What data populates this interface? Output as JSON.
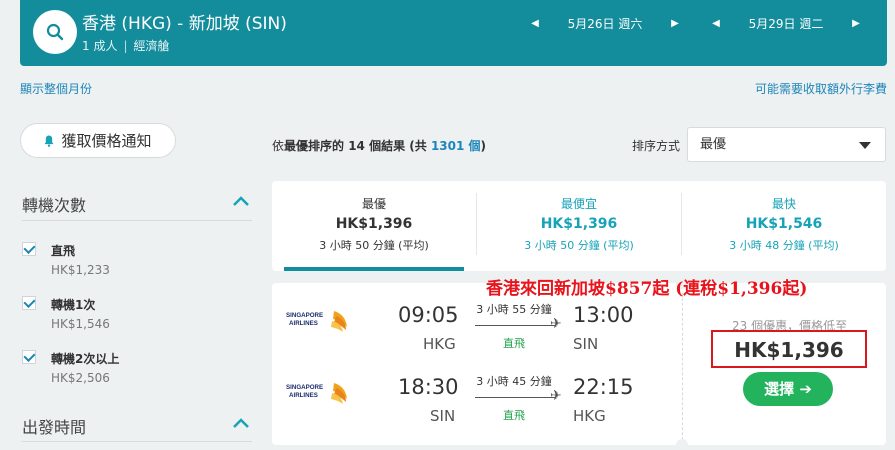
{
  "header": {
    "route": "香港 (HKG) - 新加坡 (SIN)",
    "passengers": "1 成人",
    "cabin": "經濟艙",
    "depart_date": "5月26日 週六",
    "return_date": "5月29日 週二"
  },
  "links": {
    "show_month": "顯示整個月份",
    "extra_fees": "可能需要收取額外行李費"
  },
  "alert_button": "獲取價格通知",
  "filters": {
    "stops": {
      "title": "轉機次數",
      "options": [
        {
          "label": "直飛",
          "price": "HK$1,233"
        },
        {
          "label": "轉機1次",
          "price": "HK$1,546"
        },
        {
          "label": "轉機2次以上",
          "price": "HK$2,506"
        }
      ]
    },
    "departure": {
      "title": "出發時間"
    }
  },
  "results": {
    "prefix": "依",
    "sort_name": "最優",
    "mid": "排序的 14 個結果 (共 ",
    "total": "1301 個",
    "suffix": ")"
  },
  "sort": {
    "label": "排序方式",
    "value": "最優"
  },
  "tabs": [
    {
      "title": "最優",
      "price": "HK$1,396",
      "duration": "3 小時 50 分鐘 (平均)"
    },
    {
      "title": "最便宜",
      "price": "HK$1,396",
      "duration": "3 小時 50 分鐘 (平均)"
    },
    {
      "title": "最快",
      "price": "HK$1,546",
      "duration": "3 小時 48 分鐘 (平均)"
    }
  ],
  "promo": "香港來回新加坡$857起 (連稅$1,396起)",
  "flight": {
    "outbound": {
      "depart": "09:05",
      "from": "HKG",
      "arrive": "13:00",
      "to": "SIN",
      "duration": "3 小時 55 分鐘",
      "stops": "直飛"
    },
    "inbound": {
      "depart": "18:30",
      "from": "SIN",
      "arrive": "22:15",
      "to": "HKG",
      "duration": "3 小時 45 分鐘",
      "stops": "直飛"
    },
    "airline_logo_text": [
      "SINGAPORE",
      "AIRLINES"
    ],
    "deals": "23 個優惠，價格低至",
    "price": "HK$1,396",
    "select_label": "選擇 ➔"
  },
  "colors": {
    "header": "#138d9c",
    "accent": "#17a3b7",
    "green": "#22b35c",
    "promo": "#e8141c"
  }
}
